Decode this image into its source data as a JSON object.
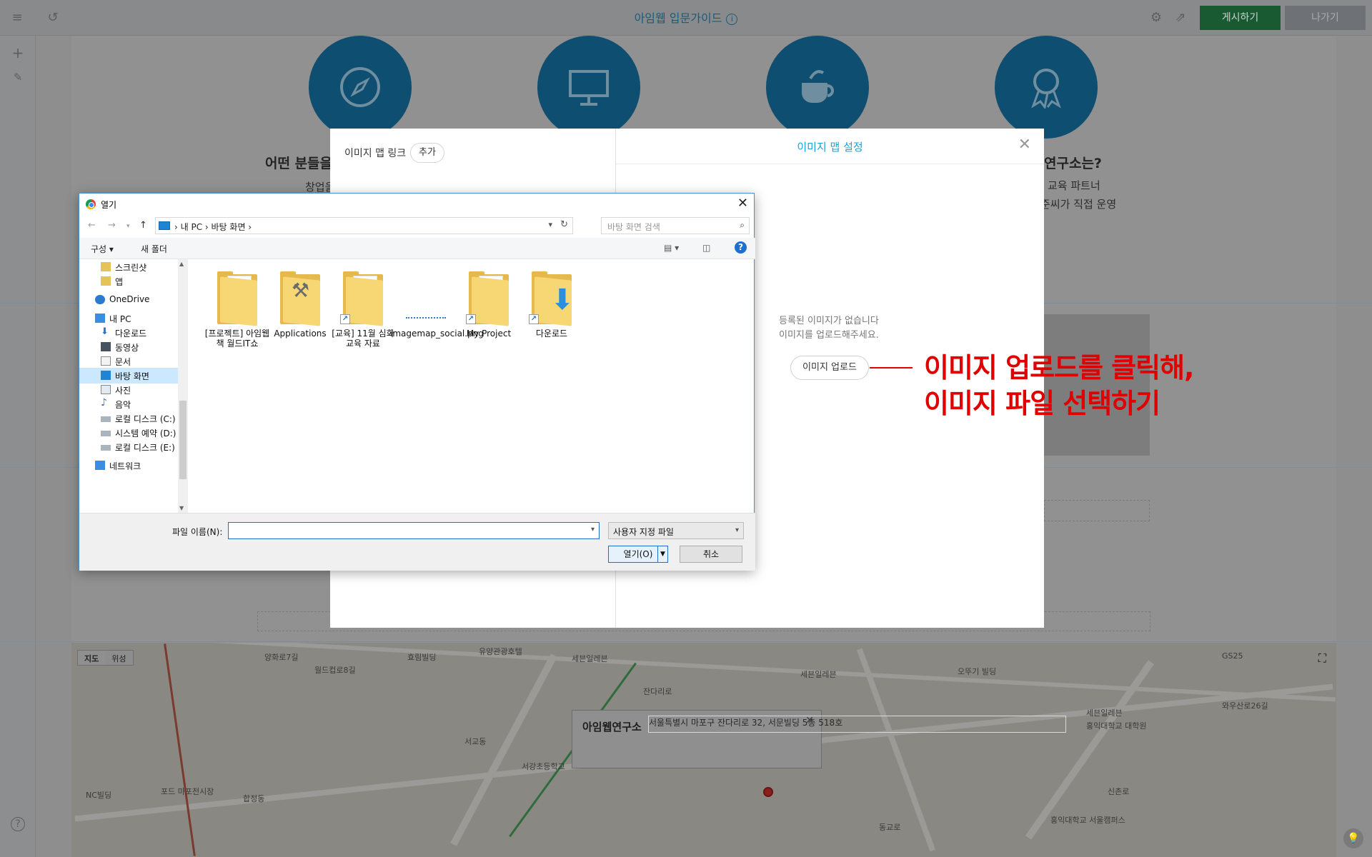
{
  "editor": {
    "title": "아임웹 입문가이드",
    "info_glyph": "i",
    "publish_label": "게시하기",
    "exit_label": "나가기",
    "menu_icon": "hamburger-icon",
    "undo_icon": "undo-icon",
    "settings_icon": "gear-icon",
    "preview_icon": "external-link-icon"
  },
  "page": {
    "section_left_title": "어떤 분들을",
    "section_left_text": "창업을",
    "section_right_title": "연구소는?",
    "section_right_line1": "교육 파트너",
    "section_right_line2": "준씨가 직접 운영"
  },
  "map": {
    "toggle_map": "지도",
    "toggle_satellite": "위성",
    "place_name": "아임웹연구소",
    "place_address": "서울특별시 마포구 잔다리로 32, 서문빌딩 5층 518호",
    "labels": [
      "양화로7길",
      "월드컵로8길",
      "효림빌딩",
      "유양관광호텔",
      "세븐일레븐",
      "잔다리로",
      "동교로",
      "서교동",
      "합정동",
      "홍익대학교 대학원",
      "오뚜기 빌딩",
      "세븐일레븐",
      "세븐일레븐",
      "GS25",
      "와우산로26길",
      "홍익대학교 서울캠퍼스",
      "신촌로",
      "NC빌딩",
      "포드 마포전시장",
      "서강초등학교"
    ]
  },
  "modal": {
    "image_map_link_label": "이미지 맵 링크",
    "add_label": "추가",
    "settings_title": "이미지 맵 설정",
    "empty_line1": "등록된 이미지가 없습니다",
    "empty_line2": "이미지를 업로드해주세요.",
    "upload_label": "이미지 업로드"
  },
  "callout": {
    "line1": "이미지 업로드를 클릭해,",
    "line2": "이미지 파일 선택하기"
  },
  "file_dialog": {
    "title": "열기",
    "breadcrumb": "›  내 PC  ›  바탕 화면  ›",
    "search_placeholder": "바탕 화면 검색",
    "organize_label": "구성 ▾",
    "new_folder_label": "새 폴더",
    "tree": [
      {
        "label": "스크린샷",
        "icon": "folder-icon"
      },
      {
        "label": "앱",
        "icon": "folder-icon"
      },
      {
        "label": "OneDrive",
        "icon": "cloud-icon"
      },
      {
        "label": "내 PC",
        "icon": "pc-icon"
      },
      {
        "label": "다운로드",
        "icon": "download-icon"
      },
      {
        "label": "동영상",
        "icon": "video-icon"
      },
      {
        "label": "문서",
        "icon": "document-icon"
      },
      {
        "label": "바탕 화면",
        "icon": "desktop-icon",
        "selected": true
      },
      {
        "label": "사진",
        "icon": "picture-icon"
      },
      {
        "label": "음악",
        "icon": "music-icon"
      },
      {
        "label": "로컬 디스크 (C:)",
        "icon": "drive-icon"
      },
      {
        "label": "시스템 예약 (D:)",
        "icon": "drive-icon"
      },
      {
        "label": "로컬 디스크 (E:)",
        "icon": "drive-icon"
      },
      {
        "label": "네트워크",
        "icon": "network-icon"
      }
    ],
    "files": [
      {
        "label": "[프로젝트] 아임웹 책 월드IT쇼",
        "type": "folder"
      },
      {
        "label": "Applications",
        "type": "folder-tools"
      },
      {
        "label": "[교육] 11월 심화 교육 자료",
        "type": "folder-shortcut"
      },
      {
        "label": "imagemap_social.png",
        "type": "image"
      },
      {
        "label": "My Project",
        "type": "folder-shortcut"
      },
      {
        "label": "다운로드",
        "type": "download-shortcut"
      }
    ],
    "filename_label": "파일 이름(N):",
    "filename_value": "",
    "filetype_value": "사용자 지정 파일",
    "open_label": "열기(O)",
    "cancel_label": "취소"
  },
  "colors": {
    "publish": "#1a5a33",
    "accent_title": "#1aa3d9",
    "callout": "#e00000",
    "circle": "#0e4e70"
  }
}
